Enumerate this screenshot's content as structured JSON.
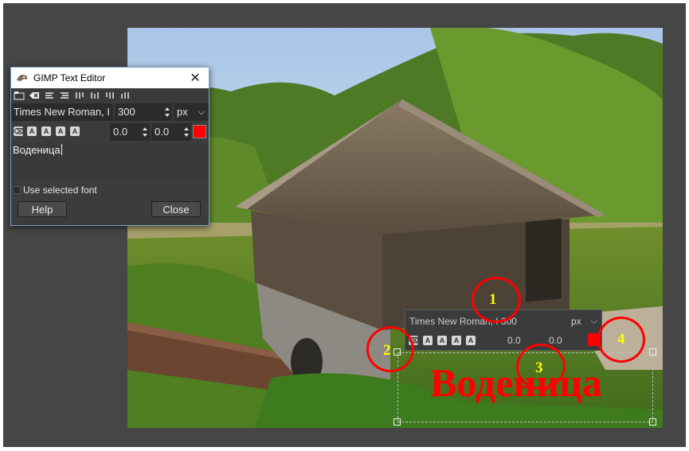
{
  "editor": {
    "title": "GIMP Text Editor",
    "font": "Times New Roman, I",
    "size": "300",
    "unit": "px",
    "baseline": "0.0",
    "kerning": "0.0",
    "color": "#ff0000",
    "text": "Воденица",
    "use_selected_font": "Use selected font",
    "help_label": "Help",
    "close_label": "Close"
  },
  "overlay": {
    "font": "Times New Roman, I 300",
    "unit": "px",
    "baseline": "0.0",
    "kerning": "0.0",
    "color": "#ff0000"
  },
  "canvas_text": "Воденица",
  "callouts": [
    "1",
    "2",
    "3",
    "4"
  ],
  "colors": {
    "annotation": "#ff0000",
    "annotation_number": "#ffff00",
    "text_color": "#ff0000"
  }
}
